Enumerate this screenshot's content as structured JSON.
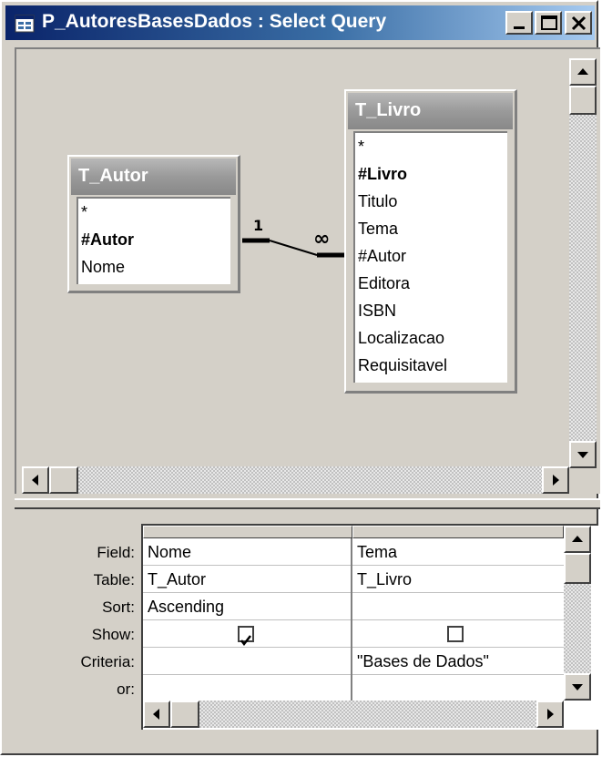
{
  "window": {
    "title": "P_AutoresBasesDados : Select Query"
  },
  "tables": [
    {
      "name": "T_Autor",
      "fields": [
        "*",
        "#Autor",
        "Nome"
      ],
      "key_field": "#Autor"
    },
    {
      "name": "T_Livro",
      "fields": [
        "*",
        "#Livro",
        "Titulo",
        "Tema",
        "#Autor",
        "Editora",
        "ISBN",
        "Localizacao",
        "Requisitavel"
      ],
      "key_field": "#Livro"
    }
  ],
  "relationship": {
    "one_label": "1",
    "many_label": "∞"
  },
  "grid": {
    "row_labels": [
      "Field:",
      "Table:",
      "Sort:",
      "Show:",
      "Criteria:",
      "or:"
    ],
    "columns": [
      {
        "field": "Nome",
        "table": "T_Autor",
        "sort": "Ascending",
        "show": true,
        "criteria": "",
        "or": ""
      },
      {
        "field": "Tema",
        "table": "T_Livro",
        "sort": "",
        "show": false,
        "criteria": "\"Bases de Dados\"",
        "or": ""
      }
    ]
  }
}
